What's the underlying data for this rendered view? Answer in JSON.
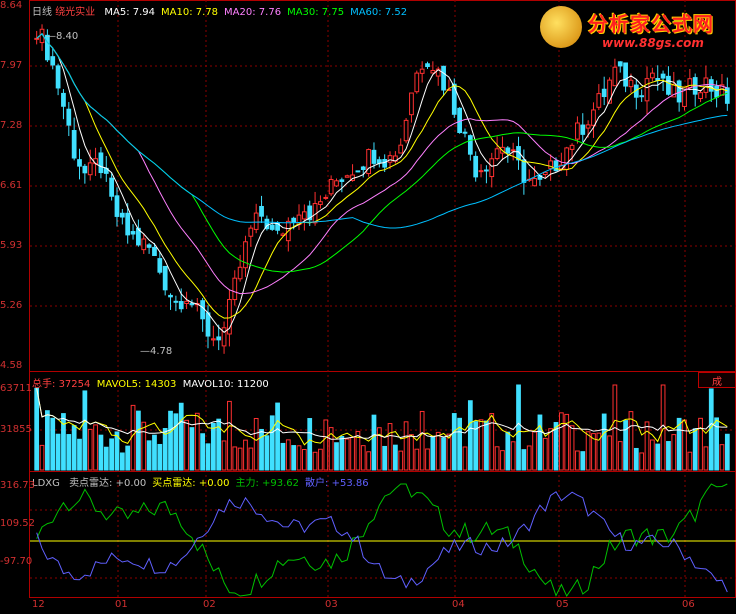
{
  "price_panel": {
    "period": "日线",
    "stock": "绕光实业",
    "ma": [
      {
        "label": "MA5:",
        "value": "7.94",
        "color": "#ffffff"
      },
      {
        "label": "MA10:",
        "value": "7.78",
        "color": "#ffff00"
      },
      {
        "label": "MA20:",
        "value": "7.76",
        "color": "#ff80ff"
      },
      {
        "label": "MA30:",
        "value": "7.75",
        "color": "#00ff00"
      },
      {
        "label": "MA60:",
        "value": "7.52",
        "color": "#00c0ff"
      }
    ],
    "y_ticks": [
      "8.64",
      "7.97",
      "7.28",
      "6.61",
      "5.93",
      "5.26",
      "4.58"
    ],
    "high_label": "8.40",
    "low_label": "4.78"
  },
  "volume_panel": {
    "label": "总手:",
    "value": "37254",
    "mavol5_label": "MAVOL5:",
    "mavol5_value": "14303",
    "mavol10_label": "MAVOL10:",
    "mavol10_value": "11200",
    "y_ticks": [
      "63711",
      "31855"
    ],
    "button": "成"
  },
  "indicator_panel": {
    "name": "LDXG",
    "items": [
      {
        "label": "卖点雷达:",
        "value": "+0.00",
        "color": "#c0c0c0"
      },
      {
        "label": "买点雷达:",
        "value": "+0.00",
        "color": "#ffff00"
      },
      {
        "label": "主力:",
        "value": "+93.62",
        "color": "#00c000"
      },
      {
        "label": "散户:",
        "value": "+53.86",
        "color": "#6060ff"
      }
    ],
    "y_ticks": [
      "316.73",
      "109.52",
      "-97.70"
    ]
  },
  "x_axis": [
    "12",
    "01",
    "02",
    "03",
    "04",
    "05",
    "06"
  ],
  "logo": {
    "title": "分析家公式网",
    "url": "www.88gs.com"
  },
  "colors": {
    "up": "#ff3030",
    "down": "#40e0ff",
    "grid": "#8b0000"
  },
  "chart_data": {
    "type": "candlestick",
    "ylim": [
      4.58,
      8.64
    ],
    "series_close": [
      8.4,
      8.1,
      7.6,
      7.0,
      6.7,
      6.9,
      6.4,
      6.1,
      6.0,
      5.9,
      5.6,
      5.3,
      5.4,
      5.1,
      4.9,
      5.0,
      5.6,
      6.1,
      6.3,
      6.0,
      6.2,
      6.4,
      6.3,
      6.5,
      6.7,
      6.8,
      6.9,
      7.0,
      6.9,
      7.1,
      7.8,
      8.1,
      7.9,
      7.6,
      7.2,
      6.8,
      6.9,
      7.1,
      6.9,
      6.7,
      6.6,
      6.8,
      7.0,
      7.2,
      7.4,
      7.6,
      7.9,
      7.8,
      7.7,
      7.9,
      7.7,
      7.6,
      7.7,
      7.8,
      7.7,
      7.6
    ]
  }
}
